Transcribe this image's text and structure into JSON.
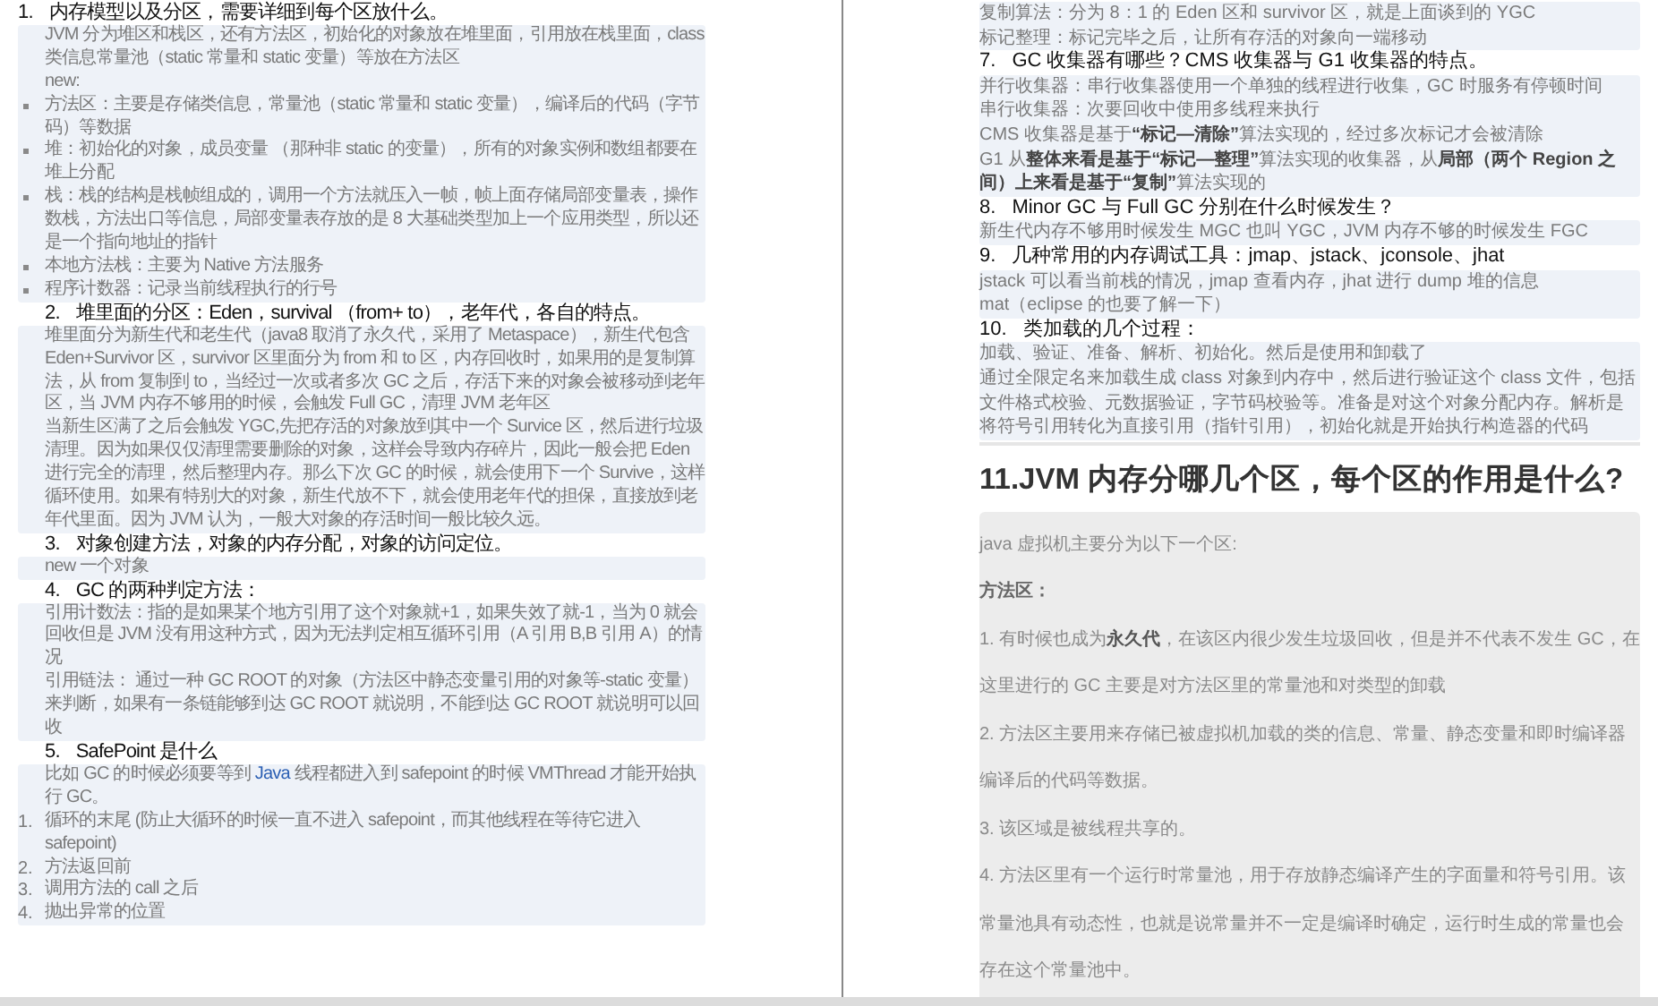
{
  "left_page": {
    "sections": [
      {
        "number": "1.",
        "title": "内存模型以及分区，需要详细到每个区放什么。",
        "body": [
          {
            "kind": "para",
            "text": "JVM 分为堆区和栈区，还有方法区，初始化的对象放在堆里面，引用放在栈里面，class 类信息常量池（static 常量和 static 变量）等放在方法区"
          },
          {
            "kind": "para",
            "text": "new:"
          },
          {
            "kind": "bullet",
            "text": "方法区：主要是存储类信息，常量池（static 常量和 static 变量），编译后的代码（字节码）等数据"
          },
          {
            "kind": "bullet",
            "text": "堆：初始化的对象，成员变量 （那种非 static 的变量），所有的对象实例和数组都要在堆上分配"
          },
          {
            "kind": "bullet",
            "text": "栈：栈的结构是栈帧组成的，调用一个方法就压入一帧，帧上面存储局部变量表，操作数栈，方法出口等信息，局部变量表存放的是 8 大基础类型加上一个应用类型，所以还是一个指向地址的指针"
          },
          {
            "kind": "bullet",
            "text": "本地方法栈：主要为 Native 方法服务"
          },
          {
            "kind": "bullet",
            "text": "程序计数器：记录当前线程执行的行号"
          }
        ]
      },
      {
        "number": "2.",
        "title": "堆里面的分区：Eden，survival （from+ to），老年代，各自的特点。",
        "body": [
          {
            "kind": "para",
            "text": "堆里面分为新生代和老生代（java8 取消了永久代，采用了 Metaspace），新生代包含 Eden+Survivor 区，survivor 区里面分为 from 和 to 区，内存回收时，如果用的是复制算法，从 from 复制到 to，当经过一次或者多次 GC 之后，存活下来的对象会被移动到老年区，当 JVM 内存不够用的时候，会触发 Full GC，清理 JVM 老年区"
          },
          {
            "kind": "para",
            "text": "当新生区满了之后会触发 YGC,先把存活的对象放到其中一个 Survice 区，然后进行垃圾清理。因为如果仅仅清理需要删除的对象，这样会导致内存碎片，因此一般会把 Eden 进行完全的清理，然后整理内存。那么下次 GC 的时候，就会使用下一个 Survive，这样循环使用。如果有特别大的对象，新生代放不下，就会使用老年代的担保，直接放到老年代里面。因为 JVM 认为，一般大对象的存活时间一般比较久远。"
          }
        ]
      },
      {
        "number": "3.",
        "title": "对象创建方法，对象的内存分配，对象的访问定位。",
        "body": [
          {
            "kind": "para",
            "text": "new 一个对象"
          }
        ]
      },
      {
        "number": "4.",
        "title": "GC 的两种判定方法：",
        "body": [
          {
            "kind": "para",
            "text": "引用计数法：指的是如果某个地方引用了这个对象就+1，如果失效了就-1，当为 0 就会回收但是 JVM 没有用这种方式，因为无法判定相互循环引用（A 引用 B,B 引用 A）的情况"
          },
          {
            "kind": "para",
            "text": "引用链法： 通过一种 GC ROOT 的对象（方法区中静态变量引用的对象等-static 变量）来判断，如果有一条链能够到达 GC ROOT 就说明，不能到达 GC ROOT 就说明可以回收"
          }
        ]
      },
      {
        "number": "5.",
        "title": "SafePoint 是什么",
        "body": [
          {
            "kind": "segments",
            "segments": [
              {
                "kind": "plain",
                "text": "比如 GC 的时候必须要等到 "
              },
              {
                "kind": "link",
                "text": "Java"
              },
              {
                "kind": "plain",
                "text": " 线程都进入到 safepoint 的时候 VMThread 才能开始执行 GC。"
              }
            ]
          },
          {
            "kind": "numbered",
            "marker": "1.",
            "text": "循环的末尾 (防止大循环的时候一直不进入 safepoint，而其他线程在等待它进入 safepoint)"
          },
          {
            "kind": "numbered",
            "marker": "2.",
            "text": "方法返回前"
          },
          {
            "kind": "numbered",
            "marker": "3.",
            "text": "调用方法的 call 之后"
          },
          {
            "kind": "numbered",
            "marker": "4.",
            "text": "抛出异常的位置"
          }
        ]
      }
    ]
  },
  "right_page": {
    "sections": [
      {
        "body": [
          {
            "kind": "para",
            "text": "复制算法：分为 8：1 的 Eden 区和 survivor 区，就是上面谈到的 YGC"
          },
          {
            "kind": "para",
            "text": "标记整理：标记完毕之后，让所有存活的对象向一端移动"
          }
        ]
      },
      {
        "number": "7.",
        "title": "GC 收集器有哪些？CMS 收集器与 G1 收集器的特点。",
        "body": [
          {
            "kind": "para",
            "text": "并行收集器：串行收集器使用一个单独的线程进行收集，GC 时服务有停顿时间"
          },
          {
            "kind": "para",
            "text": "串行收集器：次要回收中使用多线程来执行"
          },
          {
            "kind": "para",
            "text": "CMS 收集器是基于**“标记—清除”**算法实现的，经过多次标记才会被清除"
          },
          {
            "kind": "para",
            "text": "G1 从**整体来看是基于“标记—整理”**算法实现的收集器，从**局部（两个 Region 之间）上来看是基于“复制”**算法实现的"
          }
        ]
      },
      {
        "number": "8.",
        "title": "Minor GC 与 Full GC 分别在什么时候发生？",
        "body": [
          {
            "kind": "para",
            "text": "新生代内存不够用时候发生 MGC 也叫 YGC，JVM 内存不够的时候发生 FGC"
          }
        ]
      },
      {
        "number": "9.",
        "title": "几种常用的内存调试工具：jmap、jstack、jconsole、jhat",
        "body": [
          {
            "kind": "para",
            "text": "jstack 可以看当前栈的情况，jmap 查看内存，jhat 进行 dump 堆的信息"
          },
          {
            "kind": "para",
            "text": "mat（eclipse 的也要了解一下）"
          }
        ]
      },
      {
        "number": "10.",
        "title": "类加载的几个过程：",
        "body": [
          {
            "kind": "para",
            "text": "加载、验证、准备、解析、初始化。然后是使用和卸载了"
          },
          {
            "kind": "para",
            "text": "通过全限定名来加载生成 class 对象到内存中，然后进行验证这个 class 文件，包括文件格式校验、元数据验证，字节码校验等。准备是对这个对象分配内存。解析是将符号引用转化为直接引用（指针引用），初始化就是开始执行构造器的代码"
          }
        ]
      }
    ],
    "article": {
      "title": "11.JVM 内存分哪几个区，每个区的作用是什么?",
      "paragraphs": [
        {
          "kind": "plain",
          "text": "java 虚拟机主要分为以下一个区:"
        },
        {
          "kind": "bold",
          "text": "方法区："
        },
        {
          "kind": "plain",
          "text": "1. 有时候也成为**永久代**，在该区内很少发生垃圾回收，但是并不代表不发生 GC，在这里进行的 GC 主要是对方法区里的常量池和对类型的卸载"
        },
        {
          "kind": "plain",
          "text": "2. 方法区主要用来存储已被虚拟机加载的类的信息、常量、静态变量和即时编译器编译后的代码等数据。"
        },
        {
          "kind": "plain",
          "text": "3. 该区域是被线程共享的。"
        },
        {
          "kind": "plain",
          "text": "4. 方法区里有一个运行时常量池，用于存放静态编译产生的字面量和符号引用。该常量池具有动态性，也就是说常量并不一定是编译时确定，运行时生成的常量也会存在这个常量池中。"
        }
      ]
    }
  }
}
